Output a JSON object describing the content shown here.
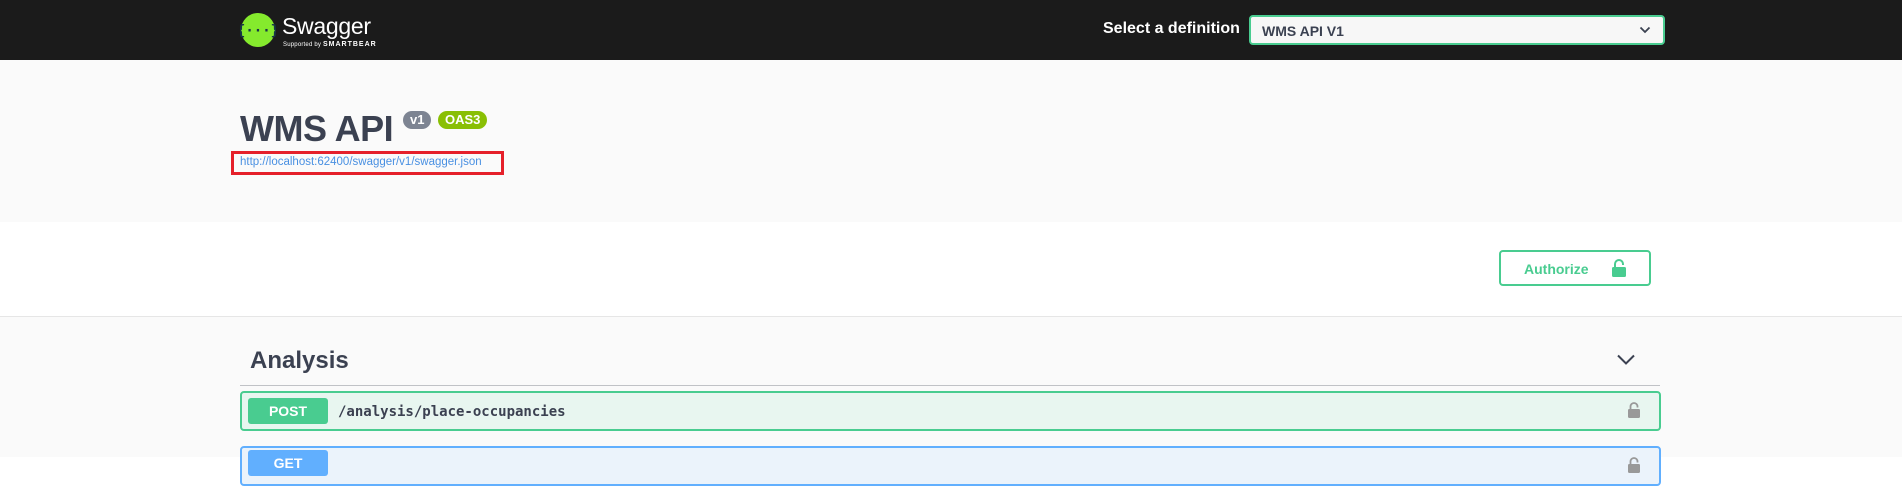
{
  "topbar": {
    "logo": {
      "wordmark": "Swagger",
      "supported_by": "Supported by",
      "brand": "SMARTBEAR"
    },
    "definition_label": "Select a definition",
    "definition_value": "WMS API V1"
  },
  "info": {
    "title": "WMS API",
    "version_badge": "v1",
    "oas_badge": "OAS3",
    "spec_url": "http://localhost:62400/swagger/v1/swagger.json"
  },
  "auth": {
    "authorize_label": "Authorize"
  },
  "tags": [
    {
      "name": "Analysis",
      "operations": [
        {
          "method": "POST",
          "path": "/analysis/place-occupancies"
        },
        {
          "method": "GET",
          "path": ""
        }
      ]
    }
  ],
  "colors": {
    "topbar_bg": "#1b1b1b",
    "swagger_green": "#85ea2d",
    "post": "#49cc90",
    "get": "#61affe",
    "version_badge": "#7d8492",
    "oas_badge": "#89bf04",
    "link": "#4990e2",
    "highlight_box": "#e5202a"
  },
  "icons": {
    "logo": "swagger-logo-icon",
    "select": "chevron-down-icon",
    "authorize": "unlocked-padlock-icon",
    "tag_toggle": "chevron-down-icon",
    "operation_lock": "unlocked-padlock-icon"
  }
}
